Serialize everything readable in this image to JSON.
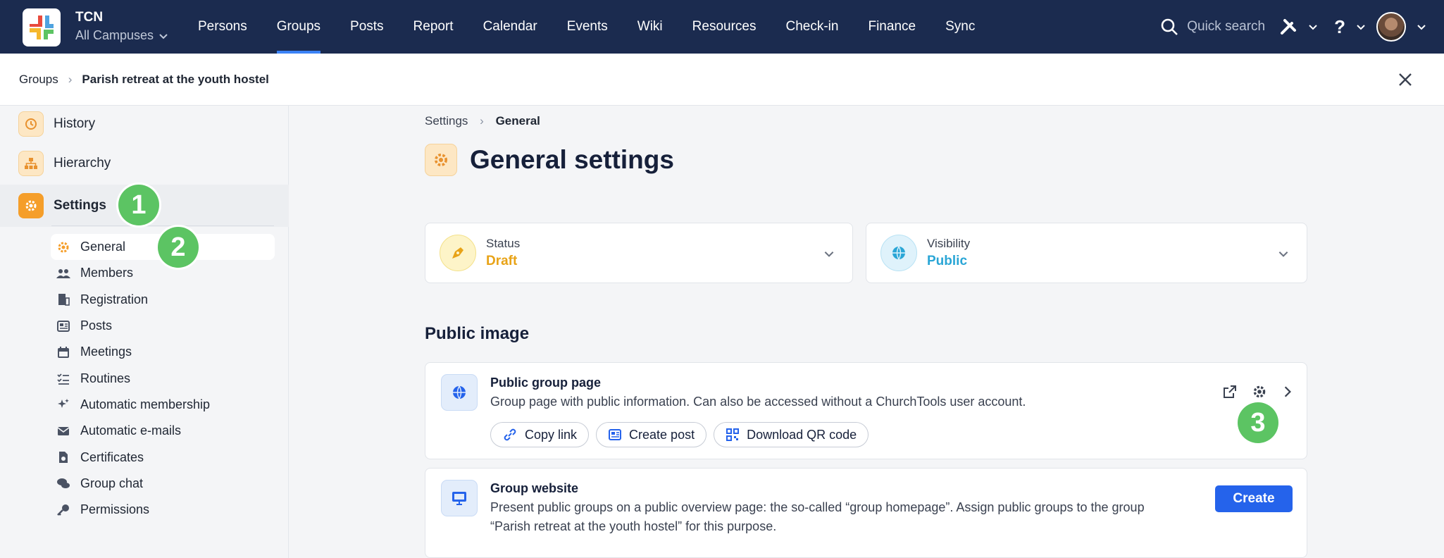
{
  "app": {
    "org_name": "TCN",
    "campus": "All Campuses"
  },
  "nav": {
    "items": [
      "Persons",
      "Groups",
      "Posts",
      "Report",
      "Calendar",
      "Events",
      "Wiki",
      "Resources",
      "Check-in",
      "Finance",
      "Sync"
    ],
    "active": "Groups",
    "quick_search": "Quick search"
  },
  "breadcrumb": {
    "root": "Groups",
    "current": "Parish retreat at the youth hostel"
  },
  "sidebar": {
    "history": "History",
    "hierarchy": "Hierarchy",
    "settings": "Settings",
    "sub": [
      "General",
      "Members",
      "Registration",
      "Posts",
      "Meetings",
      "Routines",
      "Automatic membership",
      "Automatic e-mails",
      "Certificates",
      "Group chat",
      "Permissions"
    ]
  },
  "main": {
    "crumb_root": "Settings",
    "crumb_current": "General",
    "title": "General settings",
    "status": {
      "label": "Status",
      "value": "Draft",
      "color": "#e8a317"
    },
    "visibility": {
      "label": "Visibility",
      "value": "Public",
      "color": "#2aa6d6"
    },
    "section": "Public image",
    "public_page": {
      "title": "Public group page",
      "desc": "Group page with public information. Can also be accessed without a ChurchTools user account.",
      "copy": "Copy link",
      "post": "Create post",
      "qr": "Download QR code"
    },
    "website": {
      "title": "Group website",
      "desc1": "Present public groups on a public overview page: the so-called “group homepage”. Assign public groups to the group",
      "desc2": "“Parish retreat at the youth hostel” for this purpose.",
      "create": "Create"
    }
  },
  "badges": {
    "b1": "1",
    "b2": "2",
    "b3": "3"
  }
}
